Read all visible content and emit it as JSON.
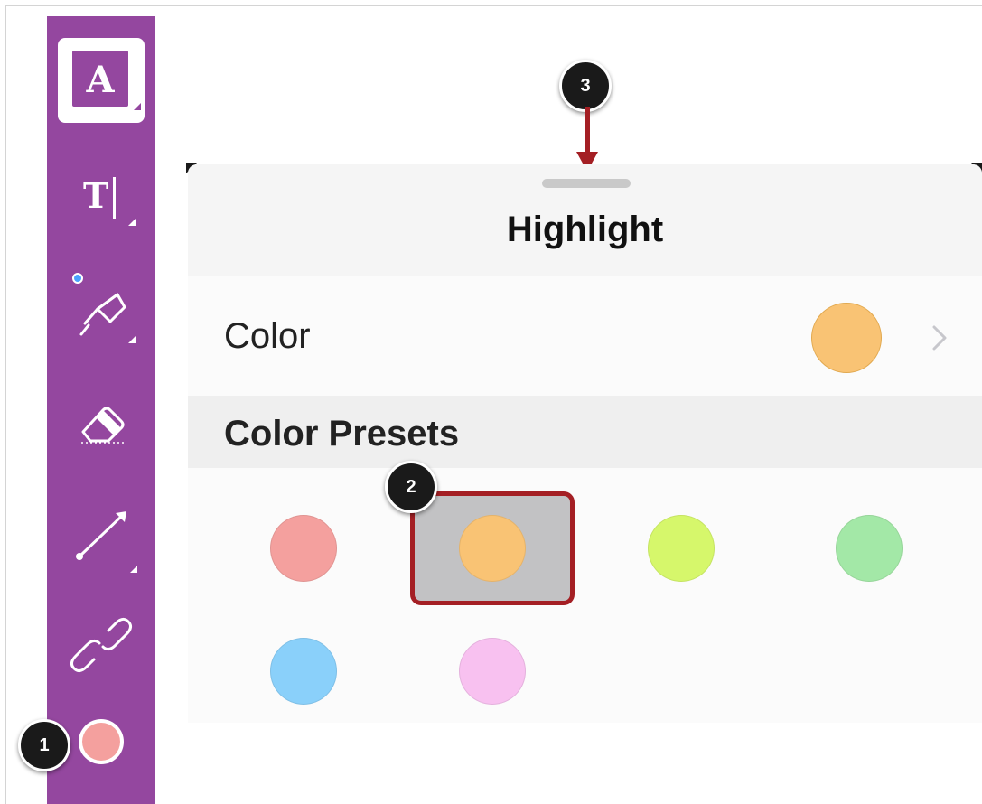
{
  "panel": {
    "title": "Highlight",
    "color_row": {
      "label": "Color",
      "current_color": "#f9c374"
    },
    "presets_label": "Color Presets",
    "presets": [
      {
        "name": "red",
        "color": "#f4a09e",
        "selected": false
      },
      {
        "name": "orange",
        "color": "#f9c374",
        "selected": true
      },
      {
        "name": "yellow-green",
        "color": "#d6f76b",
        "selected": false
      },
      {
        "name": "green",
        "color": "#a3e8a7",
        "selected": false
      },
      {
        "name": "blue",
        "color": "#8ad0fa",
        "selected": false
      },
      {
        "name": "pink",
        "color": "#f8c1f0",
        "selected": false
      }
    ]
  },
  "toolbar": {
    "background": "#94479f",
    "tools": [
      {
        "icon": "free-text-icon",
        "active": true
      },
      {
        "icon": "text-cursor-icon",
        "active": false
      },
      {
        "icon": "highlighter-icon",
        "active": false
      },
      {
        "icon": "eraser-icon",
        "active": false
      },
      {
        "icon": "line-arrow-icon",
        "active": false
      },
      {
        "icon": "link-icon",
        "active": false
      }
    ],
    "current_color": "#f4a09e"
  },
  "callouts": [
    "1",
    "2",
    "3"
  ],
  "accent": "#a41f24"
}
